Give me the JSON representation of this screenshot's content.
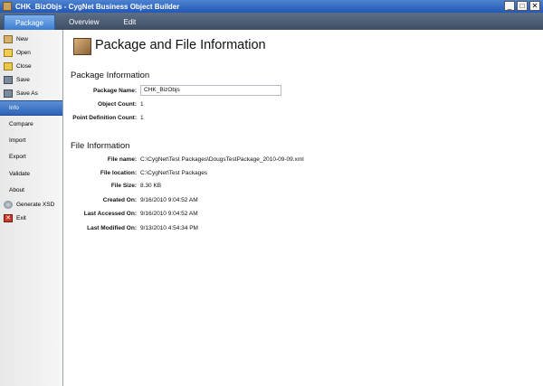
{
  "window": {
    "title": "CHK_BizObjs - CygNet Business Object Builder",
    "buttons": [
      "_",
      "□",
      "✕"
    ]
  },
  "tabs": [
    "Package",
    "Overview",
    "Edit"
  ],
  "sidebar": {
    "items": [
      {
        "label": "New",
        "icon": "new-icon"
      },
      {
        "label": "Open",
        "icon": "open-folder-icon"
      },
      {
        "label": "Close",
        "icon": "close-folder-icon"
      },
      {
        "label": "Save",
        "icon": "save-icon"
      },
      {
        "label": "Save As",
        "icon": "save-as-icon"
      },
      {
        "label": "Info"
      },
      {
        "label": "Compare"
      },
      {
        "label": "Import"
      },
      {
        "label": "Export"
      },
      {
        "label": "Validate"
      },
      {
        "label": "About"
      },
      {
        "label": "Generate XSD",
        "icon": "gear-icon"
      },
      {
        "label": "Exit",
        "icon": "exit-icon"
      }
    ]
  },
  "main": {
    "title": "Package and File Information",
    "package_section": {
      "heading": "Package Information",
      "name_label": "Package Name:",
      "name_value": "CHK_BizObjs",
      "object_count_label": "Object Count:",
      "object_count": "1",
      "point_def_label": "Point Definition Count:",
      "point_def_count": "1"
    },
    "file_section": {
      "heading": "File Information",
      "rows": [
        {
          "label": "File name:",
          "value": "C:\\CygNet\\Test Packages\\DougsTestPackage_2010-09-09.xml"
        },
        {
          "label": "File location:",
          "value": "C:\\CygNet\\Test Packages"
        },
        {
          "label": "File Size:",
          "value": "8.30 KB"
        },
        {
          "label": "Created On:",
          "value": "9/16/2010 9:04:52 AM"
        },
        {
          "label": "Last Accessed On:",
          "value": "9/16/2010 9:04:52 AM"
        },
        {
          "label": "Last Modified On:",
          "value": "9/13/2010 4:54:34 PM"
        }
      ]
    }
  }
}
